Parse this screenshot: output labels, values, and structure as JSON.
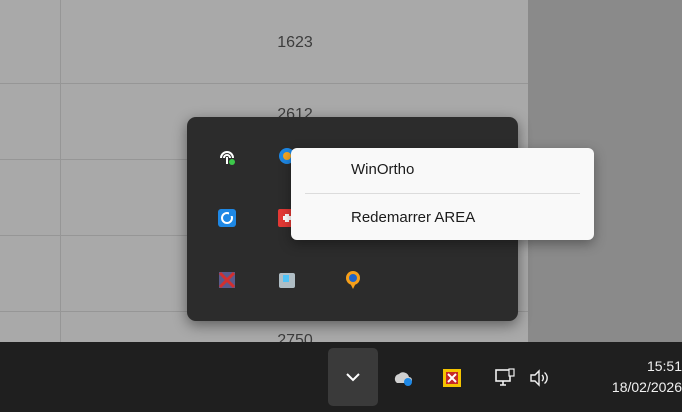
{
  "background_table": {
    "rows": [
      "1623",
      "2612",
      "2750"
    ]
  },
  "tray_overflow": {
    "icons": [
      {
        "name": "network-status-icon",
        "color": "#ffffff"
      },
      {
        "name": "app-globe-icon",
        "color": "#1e88e5"
      },
      {
        "name": "app-green-icon",
        "color": "#2e9b42"
      },
      {
        "name": "app-blue-icon",
        "color": "#1e88e5"
      },
      {
        "name": "app-cyan-icon",
        "color": "#29b6f6"
      },
      {
        "name": "sync-app-icon",
        "color": "#1e88e5"
      },
      {
        "name": "app-red-icon",
        "color": "#e53935"
      },
      {
        "name": "winortho-x-icon",
        "color": "#c62828"
      },
      {
        "name": "disk-app-icon",
        "color": "#9e9e9e"
      },
      {
        "name": "location-pin-icon",
        "color": "#f59f1a"
      }
    ]
  },
  "context_menu": {
    "items": [
      "WinOrtho",
      "Redemarrer AREA"
    ]
  },
  "taskbar": {
    "overflow_chevron": "show-hidden-icons",
    "tray_icons": [
      "onedrive-cloud-icon",
      "security-shield-icon",
      "network-monitor-icon",
      "volume-icon"
    ],
    "clock": {
      "time": "15:51",
      "date": "18/02/2026"
    }
  }
}
